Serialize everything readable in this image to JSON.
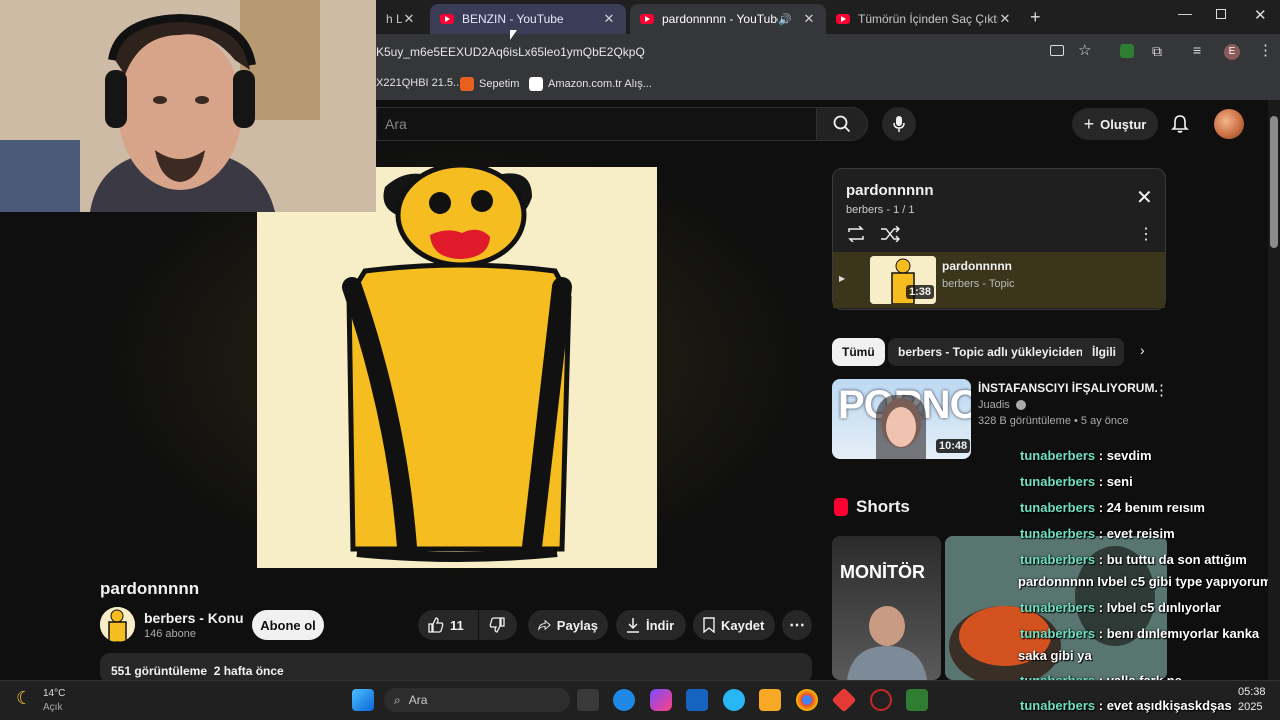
{
  "browser": {
    "tabs": [
      {
        "title": "h Liv",
        "active": false
      },
      {
        "title": "BENZIN - YouTube",
        "active": false
      },
      {
        "title": "pardonnnnn - YouTube",
        "active": true
      },
      {
        "title": "Tümörün İçinden Saç Çıktı | Baş",
        "active": false
      }
    ],
    "address": "K5uy_m6e5EEXUD2Aq6isLx65leo1ymQbE2QkpQ",
    "bookmarks": [
      {
        "label": "X221QHBI 21.5...",
        "icon": "doc-icon"
      },
      {
        "label": "Sepetim",
        "icon": "hb-icon"
      },
      {
        "label": "Amazon.com.tr Alış...",
        "icon": "amazon-icon"
      }
    ],
    "profile_initial": "E"
  },
  "youtube": {
    "search_placeholder": "Ara",
    "create_label": "Oluştur",
    "video": {
      "title": "pardonnnnn",
      "channel": "berbers - Konu",
      "subscribers": "146 abone",
      "subscribe_label": "Abone ol",
      "likes": "11",
      "share_label": "Paylaş",
      "download_label": "İndir",
      "save_label": "Kaydet",
      "views": "551 görüntüleme",
      "age": "2 hafta önce"
    },
    "playlist": {
      "title": "pardonnnnn",
      "meta": "berbers - 1 / 1",
      "item_title": "pardonnnnn",
      "item_channel": "berbers - Topic",
      "item_duration": "1:38"
    },
    "chips": [
      "Tümü",
      "berbers - Topic adlı yükleyiciden",
      "İlgili"
    ],
    "recommended": {
      "title": "İNSTAFANSCIYI İFŞALIYORUM.",
      "channel": "Juadis",
      "meta": "328 B görüntüleme • 5 ay önce",
      "duration": "10:48",
      "thumb_text": "PORNO"
    },
    "shorts_label": "Shorts",
    "short1_text": "MONİTÖR"
  },
  "chat": [
    {
      "user": "tunaberbers",
      "msg": ": sevdim"
    },
    {
      "user": "tunaberbers",
      "msg": ": seni"
    },
    {
      "user": "tunaberbers",
      "msg": ": 24 benım reısım"
    },
    {
      "user": "tunaberbers",
      "msg": ": evet reisim"
    },
    {
      "user": "tunaberbers",
      "msg": ": bu tuttu da son attığım"
    },
    {
      "user": "",
      "msg": "pardonnnnn Ivbel c5 gibi type yapıyorum"
    },
    {
      "user": "tunaberbers",
      "msg": ": Ivbel c5 dınlıyorlar"
    },
    {
      "user": "tunaberbers",
      "msg": ": benı dınlemıyorlar kanka"
    },
    {
      "user": "",
      "msg": "saka gibi ya"
    },
    {
      "user": "tunaberbers",
      "msg": ": valla fark ne"
    },
    {
      "user": "tunaberbers",
      "msg": ": evet aşıdkişaskdşas"
    }
  ],
  "taskbar": {
    "weather_temp": "14°C",
    "weather_desc": "Açık",
    "search_label": "Ara",
    "time": "05:38",
    "date": "2025"
  }
}
